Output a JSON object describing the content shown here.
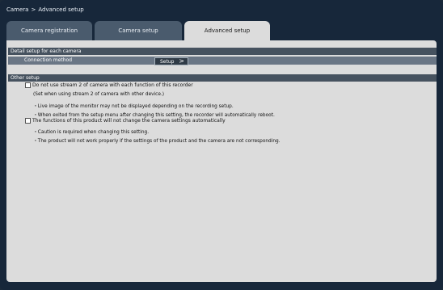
{
  "window": {
    "breadcrumb_root": "Camera",
    "breadcrumb_sep": ">",
    "breadcrumb_page": "Advanced setup"
  },
  "tabs": [
    {
      "label": "Camera registration",
      "active": false
    },
    {
      "label": "Camera setup",
      "active": false
    },
    {
      "label": "Advanced setup",
      "active": true
    }
  ],
  "detail_section": {
    "title": "Detail setup for each camera",
    "row_label": "Connection method",
    "setup_button": "Setup",
    "setup_chevron": ">"
  },
  "other_section": {
    "title": "Other setup",
    "option1": {
      "label": "Do not use stream 2 of camera with each function of this recorder",
      "checked": false,
      "notes": [
        "(Set when using stream 2 of camera with other device.)",
        "・Live image of the monitor may not be displayed depending on the recording setup.",
        "・When exited from the setup menu after changing this setting, the recorder will automatically reboot."
      ]
    },
    "option2": {
      "label": "The functions of this product will not change the camera settings automatically",
      "checked": false,
      "notes": [
        "・Caution is required when changing this setting.",
        "・The product will not work properly if the settings of the product and the camera are not corresponding."
      ]
    }
  },
  "colors": {
    "background": "#17273a",
    "tab_inactive": "#4a5b6d",
    "tab_active": "#dcdcdc",
    "panel": "#dcdcdc",
    "section_bar": "#46525f",
    "button": "#2f3a46"
  }
}
